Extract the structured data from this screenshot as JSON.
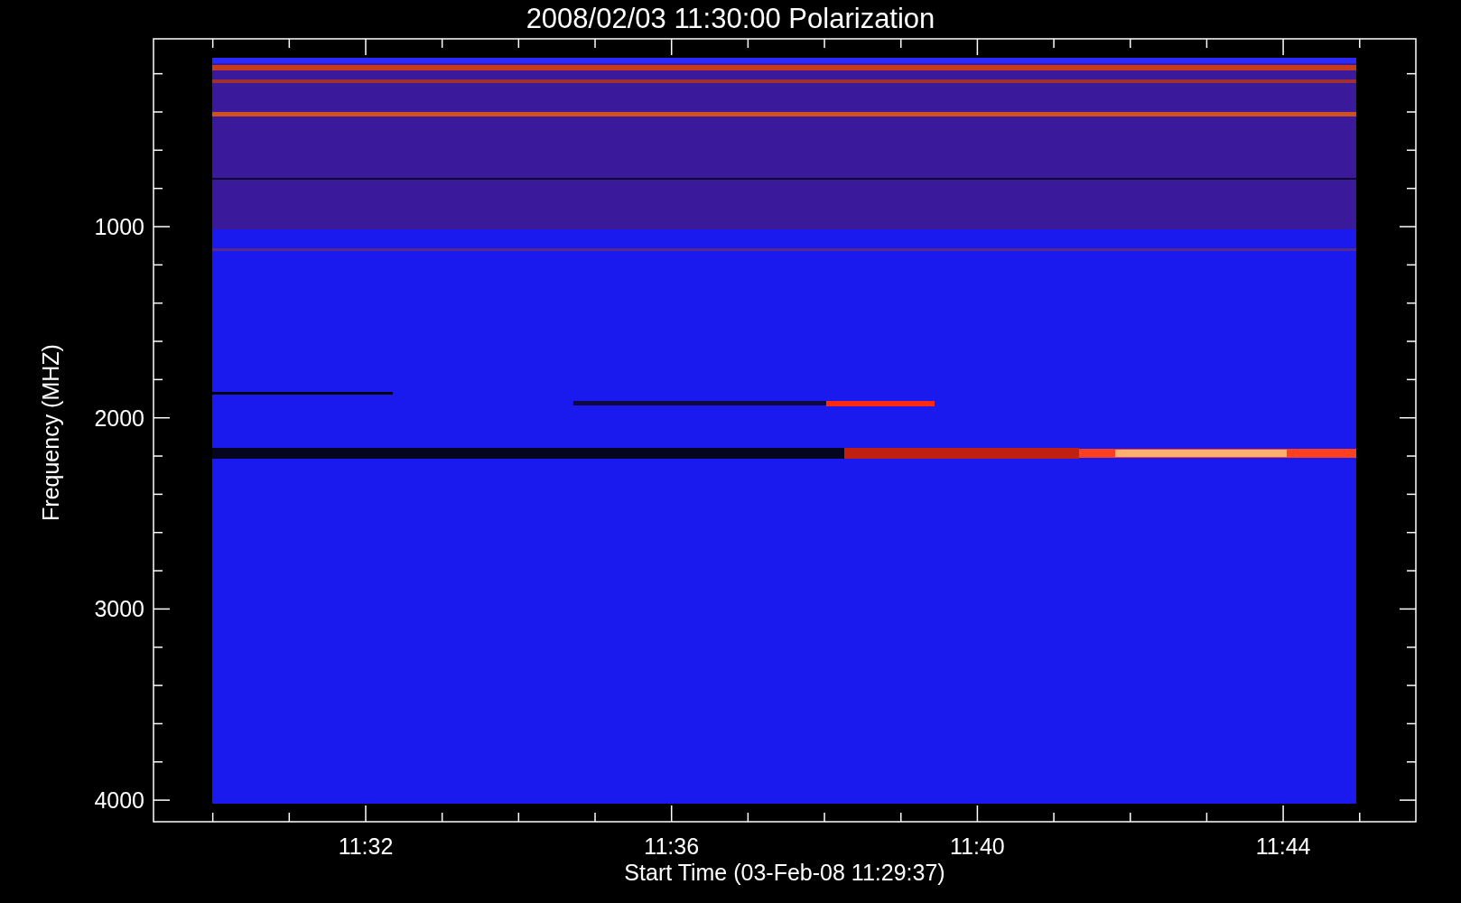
{
  "title": "2008/02/03 11:30:00 Polarization",
  "y_axis": {
    "label": "Frequency (MHZ)",
    "ticks": [
      "1000",
      "2000",
      "3000",
      "4000"
    ]
  },
  "x_axis": {
    "label": "Start Time (03-Feb-08 11:29:37)",
    "ticks": [
      "11:32",
      "11:36",
      "11:40",
      "11:44"
    ]
  }
}
